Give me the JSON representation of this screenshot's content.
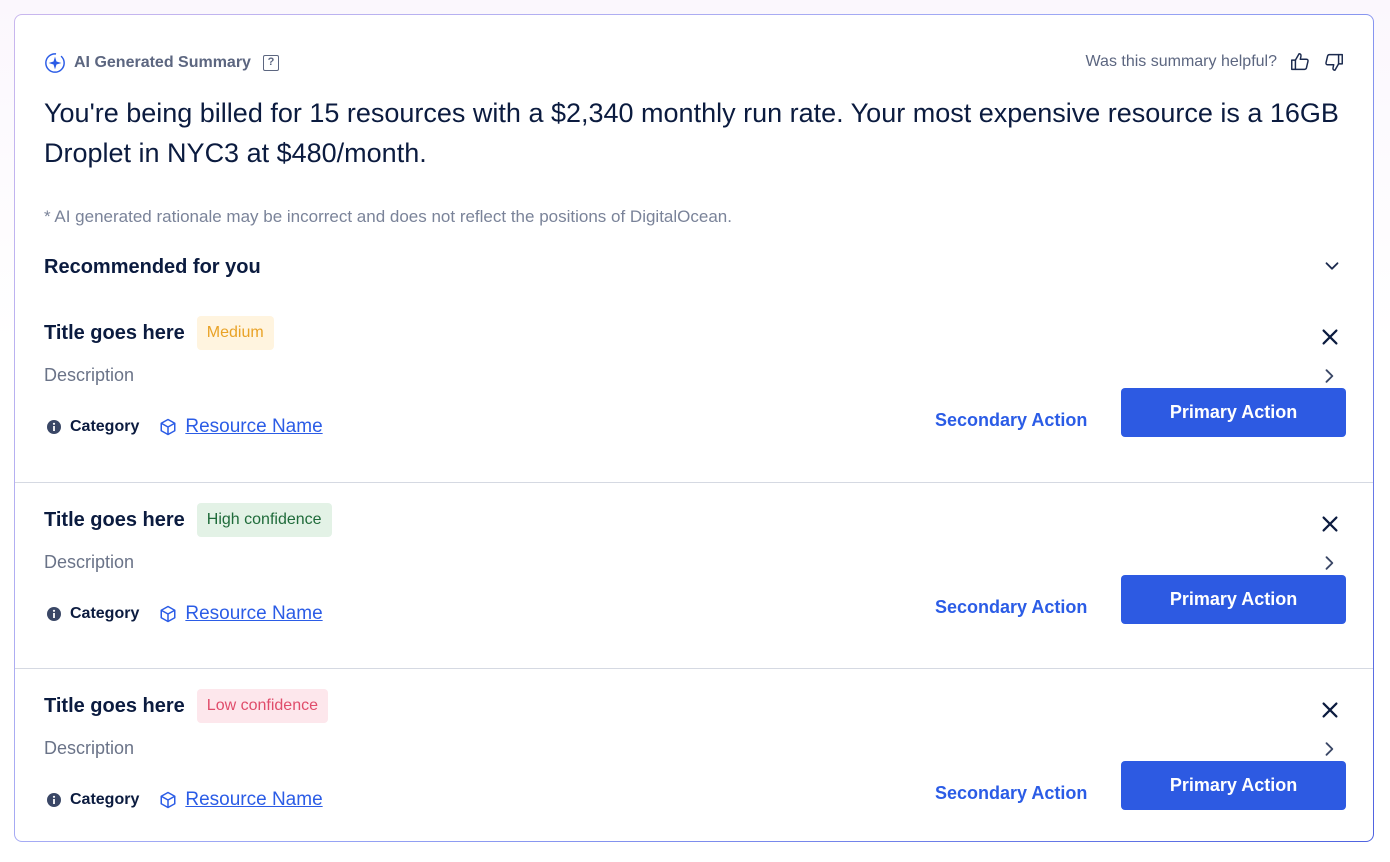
{
  "summary": {
    "label": "AI Generated Summary",
    "help_glyph": "?",
    "feedback_prompt": "Was this summary helpful?",
    "headline": "You're being billed for 15 resources with a $2,340 monthly run rate. Your most expensive resource is a 16GB Droplet in NYC3 at $480/month.",
    "disclaimer": "* AI generated rationale may be incorrect and does not reflect the positions of DigitalOcean."
  },
  "recommendations_header": "Recommended for you",
  "recommendations": [
    {
      "title": "Title goes here",
      "badge": "Medium",
      "badge_type": "medium",
      "description": "Description",
      "category": "Category",
      "resource": "Resource Name",
      "secondary_action": "Secondary Action",
      "primary_action": "Primary Action"
    },
    {
      "title": "Title goes here",
      "badge": "High confidence",
      "badge_type": "high",
      "description": "Description",
      "category": "Category",
      "resource": "Resource Name",
      "secondary_action": "Secondary Action",
      "primary_action": "Primary Action"
    },
    {
      "title": "Title goes here",
      "badge": "Low confidence",
      "badge_type": "low",
      "description": "Description",
      "category": "Category",
      "resource": "Resource Name",
      "secondary_action": "Secondary Action",
      "primary_action": "Primary Action"
    }
  ],
  "colors": {
    "primary": "#2d5ae2",
    "link": "#2b5ce6",
    "text": "#0b1b3f",
    "muted": "#6a7388",
    "badge_medium_bg": "#fff4df",
    "badge_medium_text": "#e9a226",
    "badge_high_bg": "#e3f2e6",
    "badge_high_text": "#1f6b3a",
    "badge_low_bg": "#fde7ec",
    "badge_low_text": "#e04d6b"
  }
}
